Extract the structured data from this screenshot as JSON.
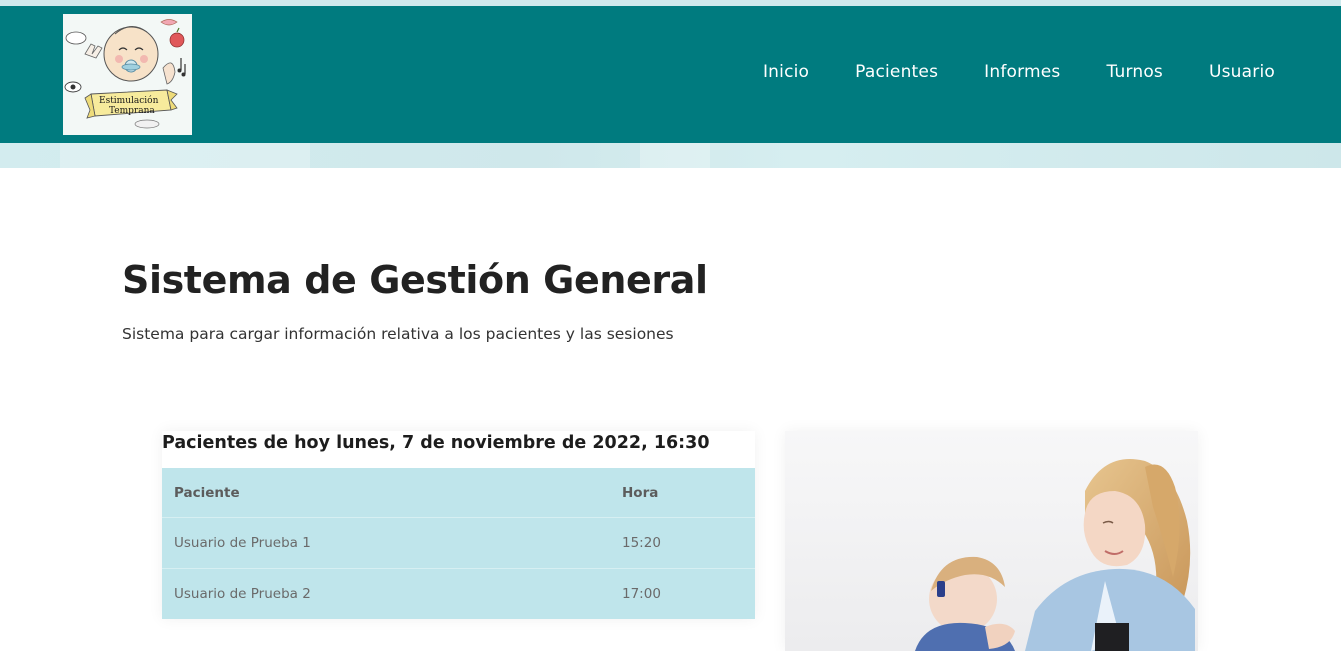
{
  "header": {
    "logo": {
      "line1": "Estimulación",
      "line2": "Temprana",
      "icon": "baby-logo"
    },
    "nav": [
      {
        "label": "Inicio"
      },
      {
        "label": "Pacientes"
      },
      {
        "label": "Informes"
      },
      {
        "label": "Turnos"
      },
      {
        "label": "Usuario"
      }
    ],
    "colors": {
      "navbar": "#007b7f",
      "strip": "#cfe9ec"
    }
  },
  "main": {
    "title": "Sistema de Gestión General",
    "subtitle": "Sistema para cargar información relativa a los pacientes y las sesiones"
  },
  "today": {
    "heading": "Pacientes de hoy lunes, 7 de noviembre de 2022, 16:30",
    "columns": {
      "patient": "Paciente",
      "time": "Hora"
    },
    "rows": [
      {
        "patient": "Usuario de Prueba 1",
        "time": "15:20"
      },
      {
        "patient": "Usuario de Prueba 2",
        "time": "17:00"
      }
    ],
    "colors": {
      "table_bg": "#bfe5eb"
    }
  },
  "image": {
    "icon": "mother-and-baby-photo"
  }
}
